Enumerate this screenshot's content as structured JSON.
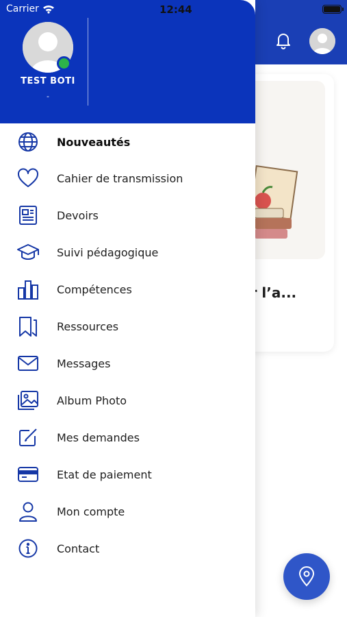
{
  "status_bar": {
    "carrier": "Carrier",
    "time": "12:44"
  },
  "profile": {
    "name": "TEST BOTI",
    "subtitle": "-"
  },
  "menu": [
    {
      "label": "Nouveautés",
      "icon": "globe-icon",
      "active": true
    },
    {
      "label": "Cahier de transmission",
      "icon": "heart-icon"
    },
    {
      "label": "Devoirs",
      "icon": "newspaper-icon"
    },
    {
      "label": "Suivi pédagogique",
      "icon": "graduation-cap-icon"
    },
    {
      "label": "Compétences",
      "icon": "bar-chart-icon"
    },
    {
      "label": "Ressources",
      "icon": "bookmarks-icon"
    },
    {
      "label": "Messages",
      "icon": "envelope-icon"
    },
    {
      "label": "Album Photo",
      "icon": "photo-album-icon"
    },
    {
      "label": "Mes demandes",
      "icon": "edit-icon"
    },
    {
      "label": "Etat de paiement",
      "icon": "credit-card-icon"
    },
    {
      "label": "Mon compte",
      "icon": "user-icon"
    },
    {
      "label": "Contact",
      "icon": "info-icon"
    }
  ],
  "background_card": {
    "title": "er l’a..."
  },
  "colors": {
    "primary": "#0b34bb",
    "header_bg": "#1a3fb5",
    "fab": "#2f56c8",
    "online": "#2db34a"
  }
}
